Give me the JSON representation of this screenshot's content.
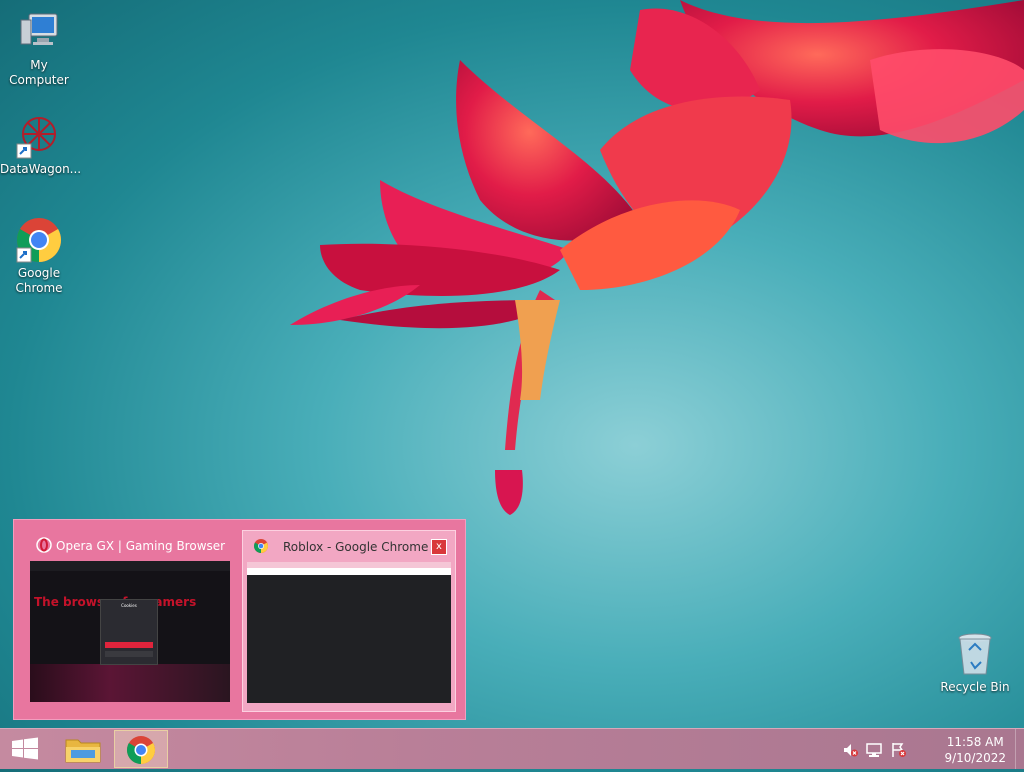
{
  "desktop": {
    "icons": [
      {
        "label": "My Computer",
        "icon": "computer-icon"
      },
      {
        "label": "DataWagon...",
        "icon": "datawagon-icon"
      },
      {
        "label": "Google\nChrome",
        "icon": "chrome-icon"
      }
    ],
    "recycle_bin": {
      "label": "Recycle Bin",
      "icon": "recycle-bin-icon"
    }
  },
  "preview": {
    "windows": [
      {
        "title": "Opera GX | Gaming Browser | O...",
        "icon": "opera-icon",
        "hero_text": "The browser for gamers",
        "dialog_title": "Cookies"
      },
      {
        "title": "Roblox - Google Chrome",
        "icon": "chrome-icon",
        "close": "x"
      }
    ]
  },
  "taskbar": {
    "start_icon": "windows-logo-icon",
    "pinned": [
      {
        "name": "file-explorer",
        "icon": "folder-icon"
      },
      {
        "name": "google-chrome",
        "icon": "chrome-icon",
        "active": true
      }
    ],
    "tray": {
      "icons": [
        "speaker-muted-icon",
        "network-icon",
        "action-center-flag-icon"
      ],
      "time": "11:58 AM",
      "date": "9/10/2022"
    }
  },
  "colors": {
    "preview_bg": "#e8769f",
    "taskbar": "#b97f98",
    "desktop": "#2a97a3"
  }
}
